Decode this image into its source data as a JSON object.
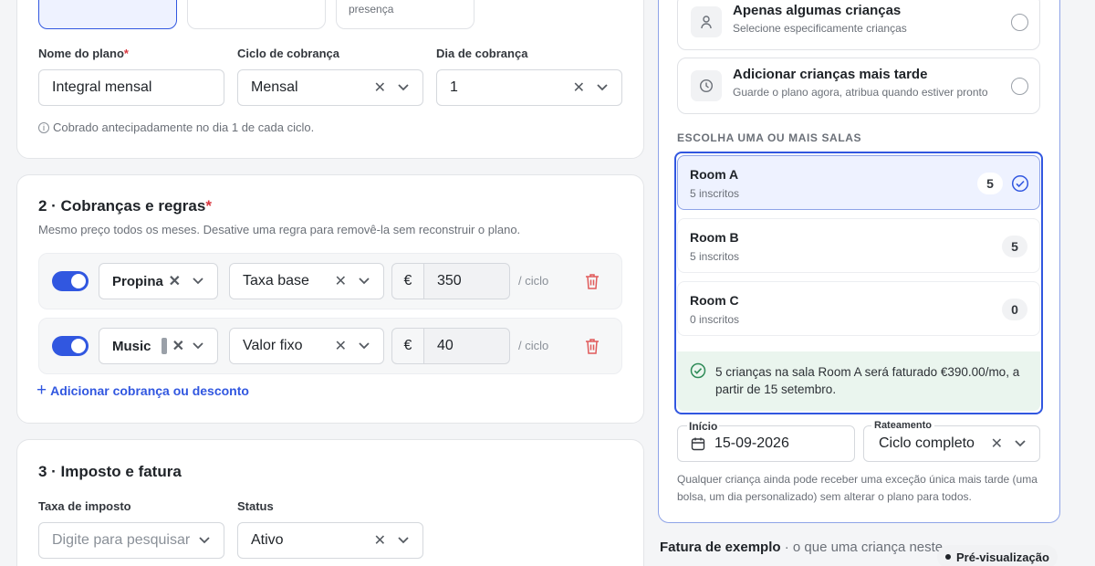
{
  "plan_section": {
    "top_option_subtext": "presença",
    "name_label": "Nome do plano",
    "name_value": "Integral mensal",
    "cycle_label": "Ciclo de cobrança",
    "cycle_value": "Mensal",
    "day_label": "Dia de cobrança",
    "day_value": "1",
    "hint": "Cobrado antecipadamente no dia 1 de cada ciclo."
  },
  "charges_section": {
    "title": "2 · Cobranças e regras",
    "subtitle": "Mesmo preço todos os meses. Desative uma regra para removê-la sem reconstruir o plano.",
    "rules": [
      {
        "name": "Propina",
        "type": "Taxa base",
        "currency": "€",
        "amount": "350",
        "per": "/ ciclo",
        "enabled": true
      },
      {
        "name": "Music",
        "type": "Valor fixo",
        "currency": "€",
        "amount": "40",
        "per": "/ ciclo",
        "enabled": true
      }
    ],
    "add_label": "Adicionar cobrança ou desconto"
  },
  "tax_section": {
    "title": "3 · Imposto e fatura",
    "tax_label": "Taxa de imposto",
    "tax_placeholder": "Digite para pesquisar",
    "status_label": "Status",
    "status_value": "Ativo"
  },
  "assign_panel": {
    "options": [
      {
        "title": "Apenas algumas crianças",
        "subtitle": "Selecione especificamente crianças",
        "icon": "person-icon"
      },
      {
        "title": "Adicionar crianças mais tarde",
        "subtitle": "Guarde o plano agora, atribua quando estiver pronto",
        "icon": "clock-icon"
      }
    ],
    "rooms_heading": "ESCOLHA UMA OU MAIS SALAS",
    "rooms": [
      {
        "name": "Room A",
        "count_text": "5 inscritos",
        "badge": "5",
        "selected": true
      },
      {
        "name": "Room B",
        "count_text": "5 inscritos",
        "badge": "5",
        "selected": false
      },
      {
        "name": "Room C",
        "count_text": "0 inscritos",
        "badge": "0",
        "selected": false
      }
    ],
    "summary": "5 crianças na sala Room A será faturado €390.00/mo, a partir de 15 setembro.",
    "start_label": "Início",
    "start_value": "15-09-2026",
    "prorate_label": "Rateamento",
    "prorate_value": "Ciclo completo",
    "footnote": "Qualquer criança ainda pode receber uma exceção única mais tarde (uma bolsa, um dia personalizado) sem alterar o plano para todos."
  },
  "invoice_preview": {
    "title": "Fatura de exemplo",
    "subtitle": "· o que uma criança neste",
    "badge": "Pré-visualização"
  },
  "colors": {
    "accent": "#3157e0",
    "danger": "#d9363e",
    "success_bg": "#eaf5ee",
    "success": "#2e8b57"
  }
}
